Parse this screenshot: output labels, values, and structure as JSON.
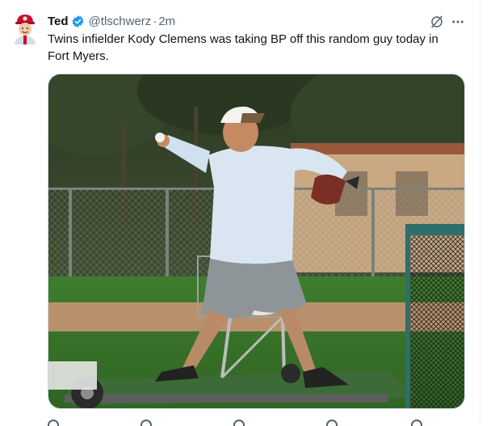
{
  "tweet": {
    "author_name": "Ted",
    "handle": "@tlschwerz",
    "separator": "·",
    "time": "2m",
    "text": "Twins infielder Kody Clemens was taking BP off this random guy today in Fort Myers."
  },
  "icons": {
    "verified": "verified-badge-icon",
    "grok": "grok-icon",
    "more": "more-options-icon"
  },
  "colors": {
    "verified": "#1d9bf0",
    "secondary_text": "#536471",
    "primary_text": "#0f1419"
  }
}
